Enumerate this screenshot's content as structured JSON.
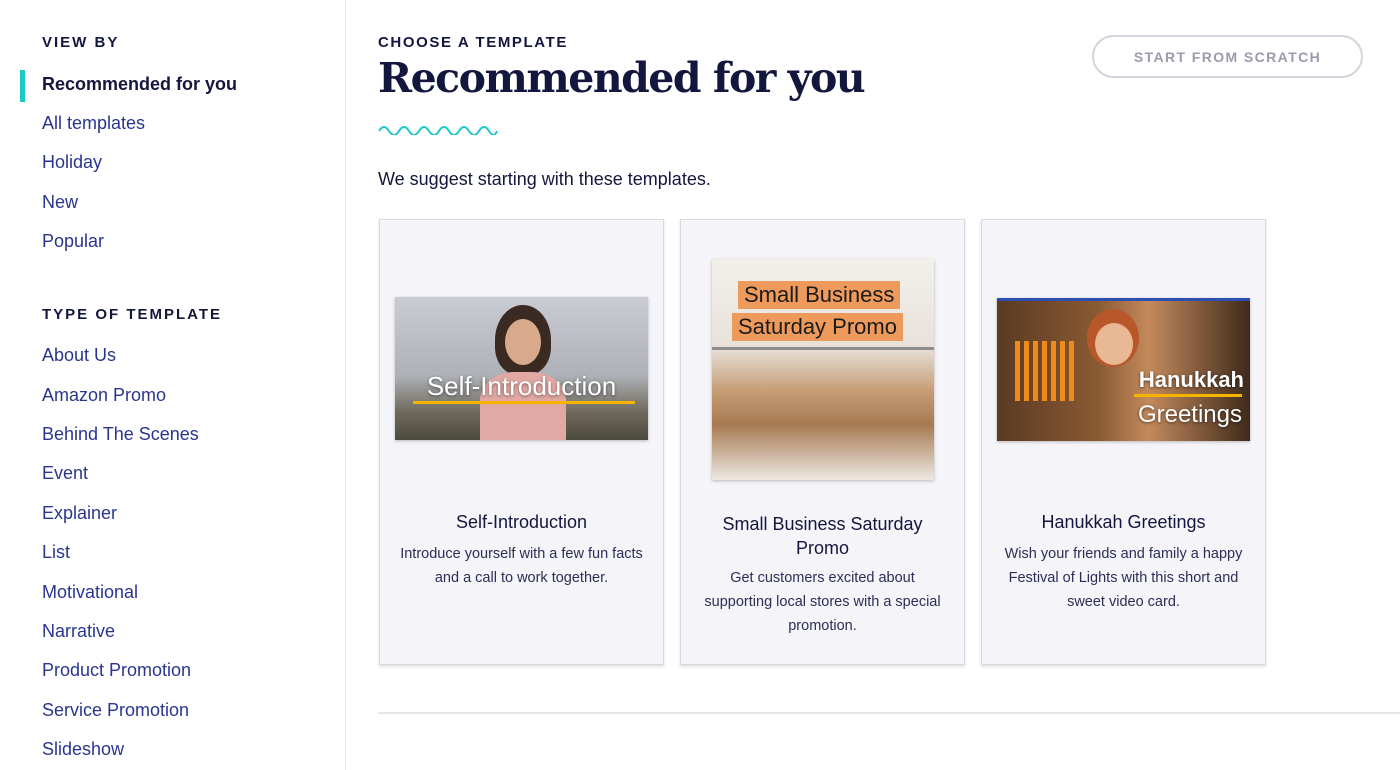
{
  "sidebar": {
    "view_by_heading": "VIEW BY",
    "view_by": [
      "Recommended for you",
      "All templates",
      "Holiday",
      "New",
      "Popular"
    ],
    "type_heading": "TYPE OF TEMPLATE",
    "types": [
      "About Us",
      "Amazon Promo",
      "Behind The Scenes",
      "Event",
      "Explainer",
      "List",
      "Motivational",
      "Narrative",
      "Product Promotion",
      "Service Promotion",
      "Slideshow"
    ]
  },
  "header": {
    "eyebrow": "CHOOSE A TEMPLATE",
    "title": "Recommended for you",
    "subtitle": "We suggest starting with these templates.",
    "scratch_button": "START FROM SCRATCH"
  },
  "colors": {
    "accent": "#1fc8c8",
    "nav": "#2a3590",
    "heading": "#13173d"
  },
  "cards": [
    {
      "title": "Self-Introduction",
      "desc": "Introduce yourself with a few fun facts and a call to work together.",
      "thumb": [
        "Self-Introduction"
      ]
    },
    {
      "title": "Small Business Saturday Promo",
      "desc": "Get customers excited about supporting local stores with a special promotion.",
      "thumb": [
        "Small Business",
        "Saturday Promo"
      ]
    },
    {
      "title": "Hanukkah Greetings",
      "desc": "Wish your friends and family a happy Festival of Lights with this short and sweet video card.",
      "thumb": [
        "Hanukkah",
        "Greetings"
      ]
    }
  ]
}
